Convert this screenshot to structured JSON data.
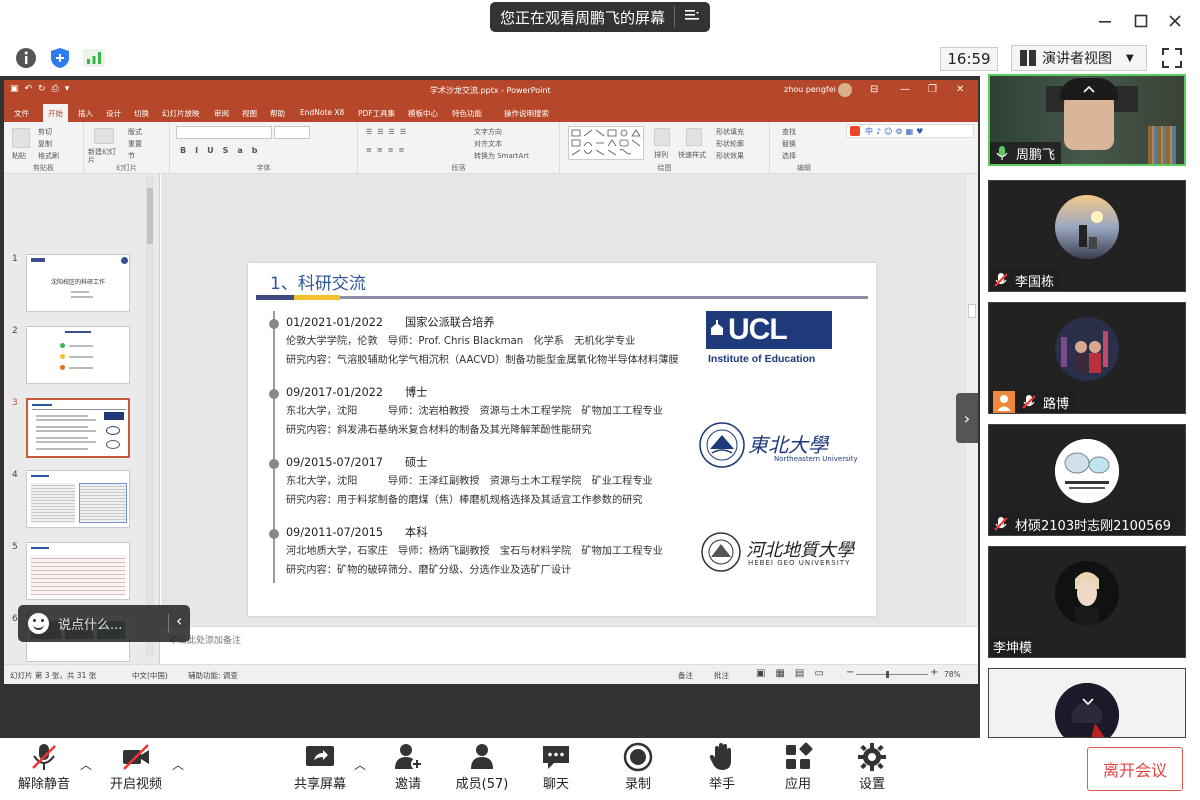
{
  "window": {
    "share_banner": "您正在观看周鹏飞的屏幕",
    "clock": "16:59",
    "view_mode": "演讲者视图"
  },
  "ppt": {
    "filename": "学术沙龙交流.pptx - PowerPoint",
    "user": "zhou pengfei",
    "tabs": [
      "文件",
      "开始",
      "插入",
      "设计",
      "切换",
      "幻灯片放映",
      "审阅",
      "视图",
      "帮助",
      "EndNote X8",
      "PDF工具集",
      "模板中心",
      "特色功能",
      "操作说明搜索"
    ],
    "ribbon": {
      "clipboard": "剪贴板",
      "slides": "幻灯片",
      "font": "字体",
      "paragraph": "段落",
      "drawing": "绘图",
      "editing": "编辑",
      "paste": "粘贴",
      "cut": "剪切",
      "copy": "复制",
      "format_painter": "格式刷",
      "new_slide": "新建幻灯片",
      "layout": "版式",
      "reset": "重置",
      "section": "节",
      "text_direction": "文字方向",
      "align_text": "对齐文本",
      "smartart": "转换为 SmartArt",
      "arrange": "排列",
      "quick_styles": "快速样式",
      "shape_fill": "形状填充",
      "shape_outline": "形状轮廓",
      "shape_effects": "形状效果",
      "find": "查找",
      "replace": "替换",
      "select": "选择"
    },
    "thumb_numbers": [
      "1",
      "2",
      "3",
      "4",
      "5",
      "6"
    ],
    "thumb1_title": "沈阳校区的科研工作",
    "slide": {
      "title": "1、科研交流",
      "entries": [
        {
          "period": "01/2021-01/2022",
          "degree": "国家公派联合培养",
          "line2": "伦敦大学学院，伦敦　导师：Prof. Chris Blackman　化学系　无机化学专业",
          "line3": "研究内容：气溶胶辅助化学气相沉积（AACVD）制备功能型金属氧化物半导体材料薄膜"
        },
        {
          "period": "09/2017-01/2022",
          "degree": "博士",
          "line2": "东北大学，沈阳　　　导师：沈岩柏教授　资源与土木工程学院　矿物加工工程专业",
          "line3": "研究内容：斜发沸石基纳米复合材料的制备及其光降解苯酚性能研究"
        },
        {
          "period": "09/2015-07/2017",
          "degree": "硕士",
          "line2": "东北大学，沈阳　　　导师：王泽红副教授　资源与土木工程学院　矿业工程专业",
          "line3": "研究内容：用于料浆制备的磨煤（焦）棒磨机规格选择及其适宜工作参数的研究"
        },
        {
          "period": "09/2011-07/2015",
          "degree": "本科",
          "line2": "河北地质大学，石家庄　导师：杨炳飞副教授　宝石与材料学院　矿物加工工程专业",
          "line3": "研究内容：矿物的破碎筛分、磨矿分级、分选作业及选矿厂设计"
        }
      ],
      "ucl_text": "UCL",
      "ucl_sub": "Institute of Education",
      "neu_name": "東北大學",
      "neu_sub": "Northeastern University",
      "hgu_name": "河北地質大學",
      "hgu_sub": "HEBEI GEO UNIVERSITY"
    },
    "notes_placeholder": "单击此处添加备注",
    "status": {
      "slide_count": "幻灯片 第 3 张，共 31 张",
      "language": "中文(中国)",
      "accessibility": "辅助功能: 调查",
      "notes_btn": "备注",
      "comments_btn": "批注",
      "zoom": "78%"
    }
  },
  "chat": {
    "placeholder": "说点什么..."
  },
  "participants": [
    {
      "name": "周鹏飞"
    },
    {
      "name": "李国栋"
    },
    {
      "name": "路博"
    },
    {
      "name": "材硕2103时志刚2100569"
    },
    {
      "name": "李坤模"
    }
  ],
  "controls": {
    "unmute": "解除静音",
    "video": "开启视频",
    "share": "共享屏幕",
    "invite": "邀请",
    "members": "成员(57)",
    "chat": "聊天",
    "record": "录制",
    "raise_hand": "举手",
    "apps": "应用",
    "settings": "设置",
    "leave": "离开会议"
  }
}
